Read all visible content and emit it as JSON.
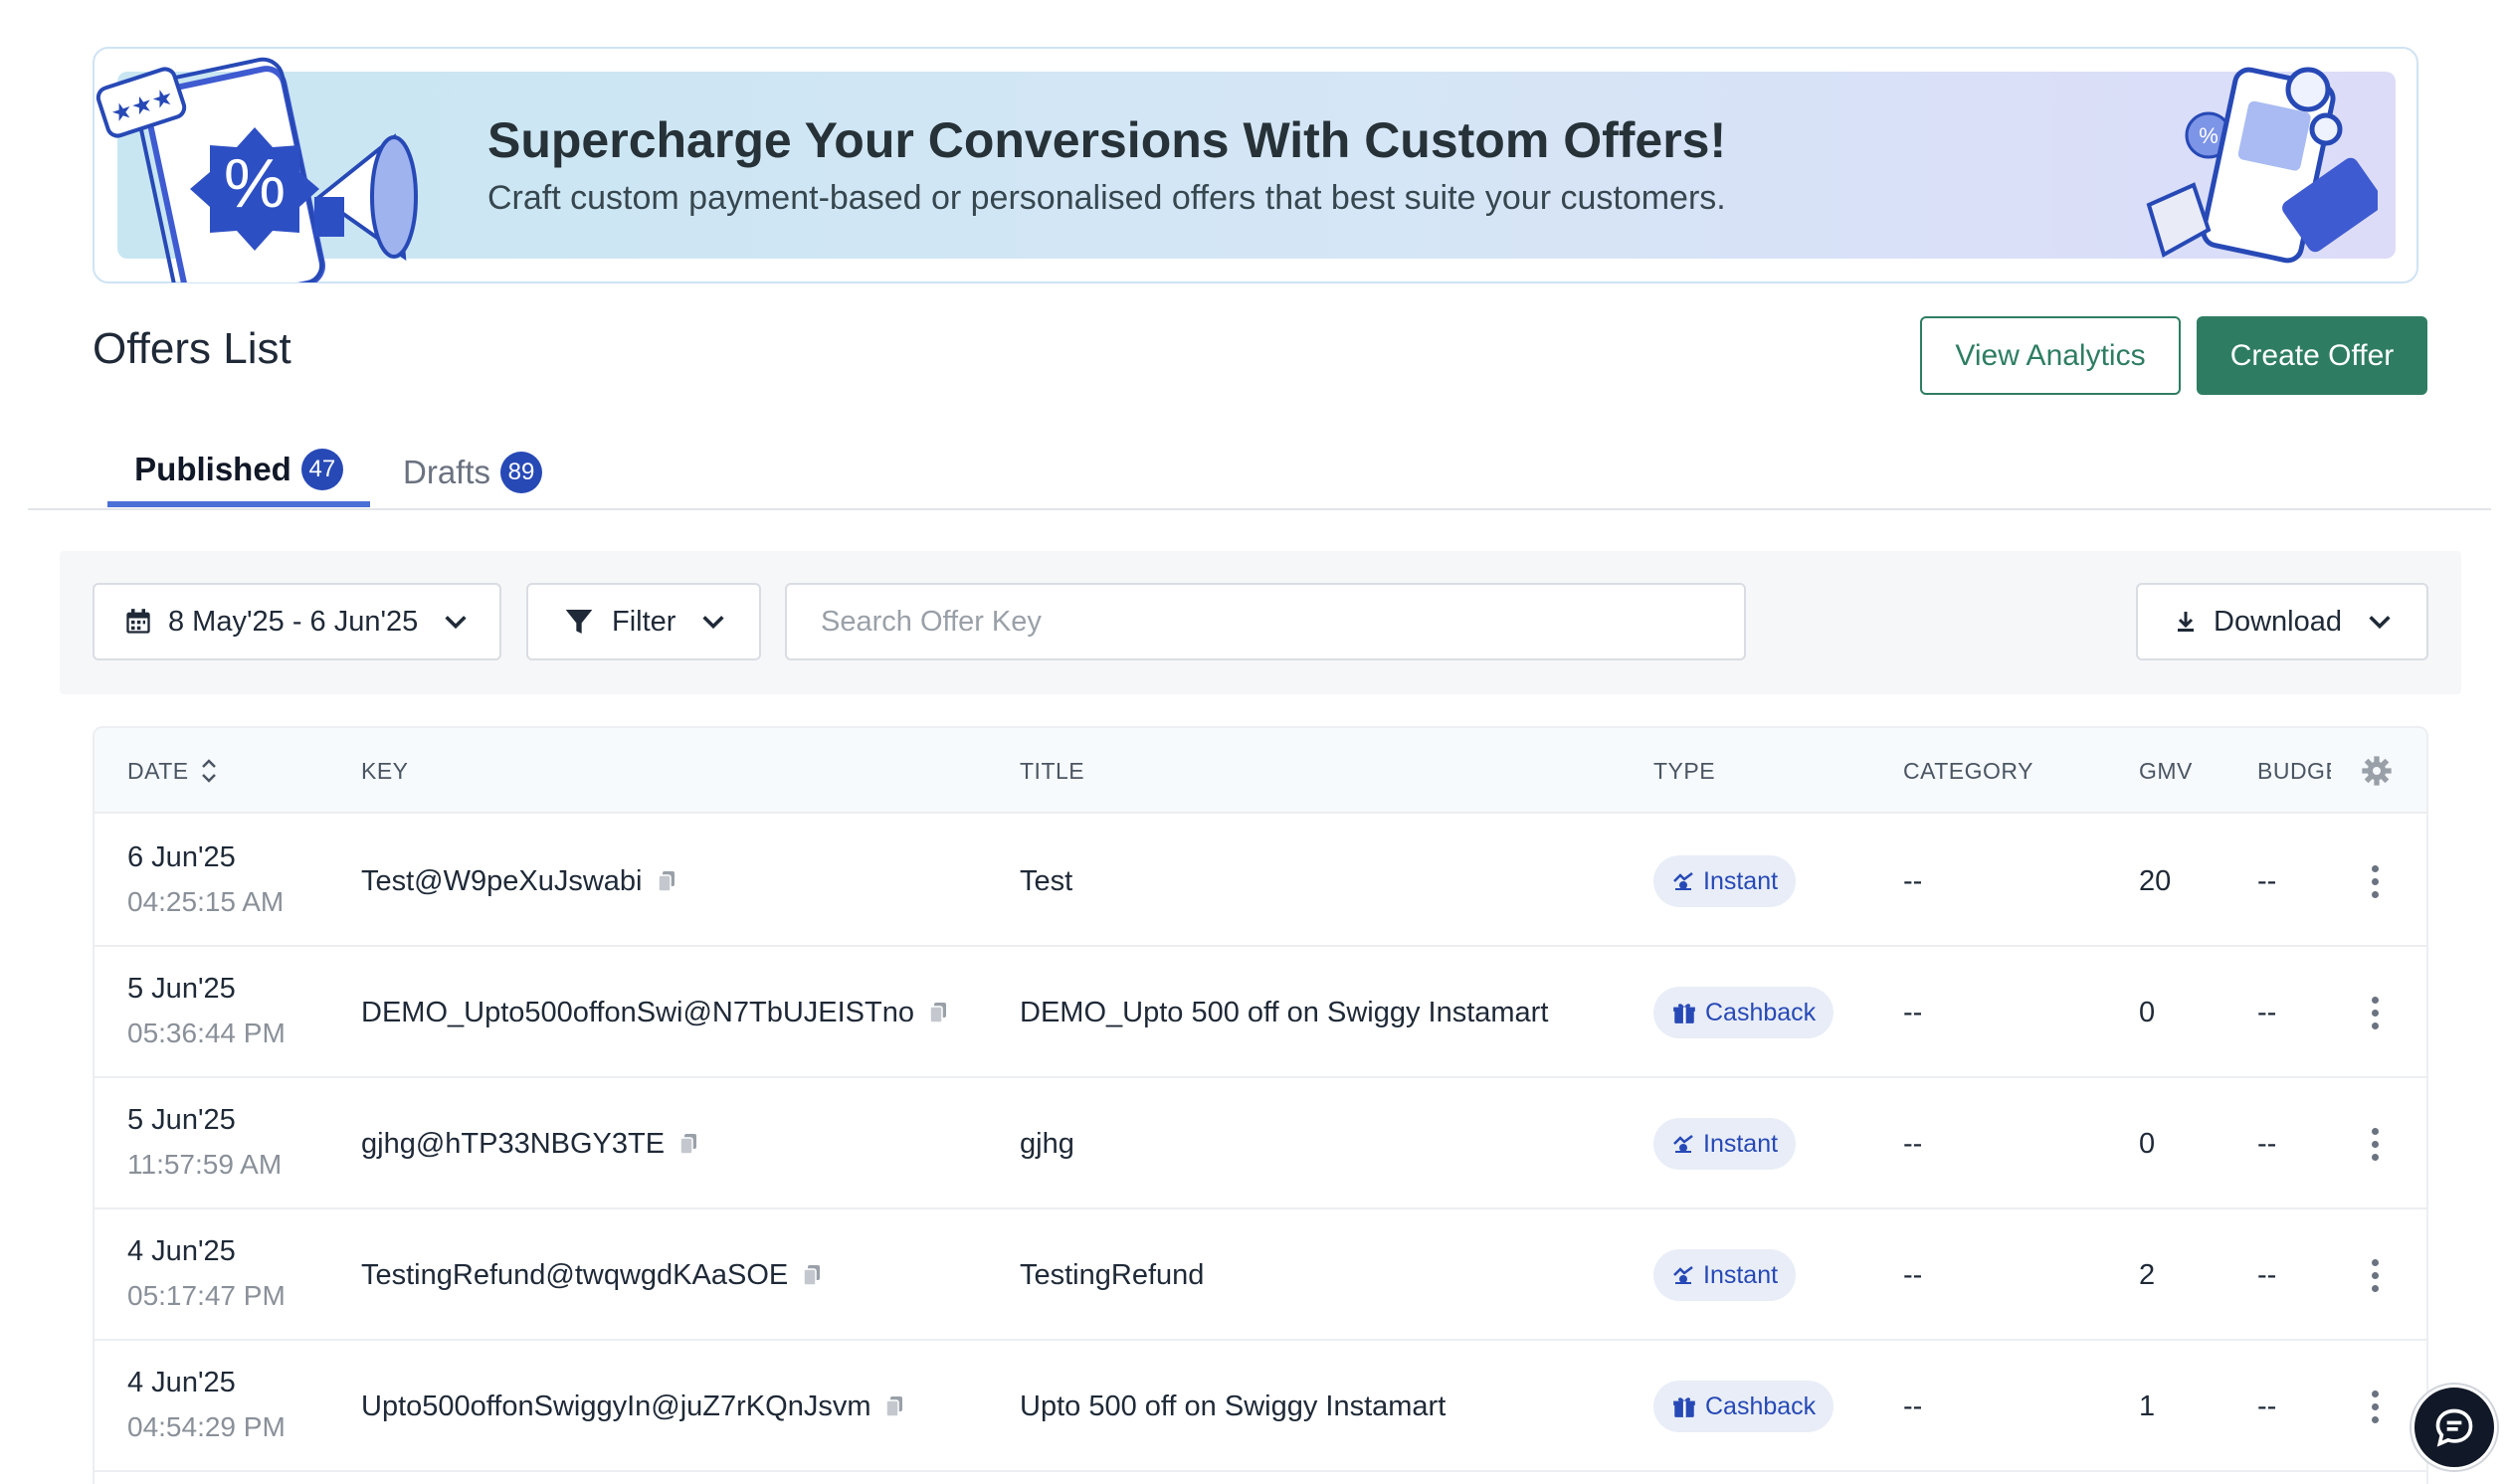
{
  "banner": {
    "title": "Supercharge Your Conversions With Custom Offers!",
    "subtitle": "Craft custom payment-based or personalised offers that best suite your customers."
  },
  "header": {
    "title": "Offers List",
    "view_analytics_label": "View Analytics",
    "create_offer_label": "Create Offer"
  },
  "tabs": [
    {
      "label": "Published",
      "count": "47"
    },
    {
      "label": "Drafts",
      "count": "89"
    }
  ],
  "toolbar": {
    "date_range": "8 May'25 - 6 Jun'25",
    "filter_label": "Filter",
    "search_placeholder": "Search Offer Key",
    "download_label": "Download"
  },
  "table": {
    "columns": [
      "DATE",
      "KEY",
      "TITLE",
      "TYPE",
      "CATEGORY",
      "GMV",
      "BUDGE"
    ],
    "rows": [
      {
        "date": "6 Jun'25",
        "time": "04:25:15 AM",
        "key": "Test@W9peXuJswabi",
        "title": "Test",
        "type": "Instant",
        "category": "--",
        "gmv": "20",
        "budget": "--"
      },
      {
        "date": "5 Jun'25",
        "time": "05:36:44 PM",
        "key": "DEMO_Upto500offonSwi@N7TbUJEISTno",
        "title": "DEMO_Upto 500 off on Swiggy Instamart",
        "type": "Cashback",
        "category": "--",
        "gmv": "0",
        "budget": "--"
      },
      {
        "date": "5 Jun'25",
        "time": "11:57:59 AM",
        "key": "gjhg@hTP33NBGY3TE",
        "title": "gjhg",
        "type": "Instant",
        "category": "--",
        "gmv": "0",
        "budget": "--"
      },
      {
        "date": "4 Jun'25",
        "time": "05:17:47 PM",
        "key": "TestingRefund@twqwgdKAaSOE",
        "title": "TestingRefund",
        "type": "Instant",
        "category": "--",
        "gmv": "2",
        "budget": "--"
      },
      {
        "date": "4 Jun'25",
        "time": "04:54:29 PM",
        "key": "Upto500offonSwiggyIn@juZ7rKQnJsvm",
        "title": "Upto 500 off on Swiggy Instamart",
        "type": "Cashback",
        "category": "--",
        "gmv": "1",
        "budget": "--"
      }
    ]
  },
  "colors": {
    "primary_green": "#2e7d62",
    "tab_accent": "#4a6fd6",
    "badge_blue": "#2749b6",
    "pill_bg": "#e8edf7"
  },
  "icons": [
    "calendar-icon",
    "chevron-down-icon",
    "funnel-icon",
    "download-icon",
    "sort-icon",
    "gear-icon",
    "copy-icon",
    "instant-icon",
    "gift-icon",
    "kebab-icon",
    "chat-icon"
  ]
}
